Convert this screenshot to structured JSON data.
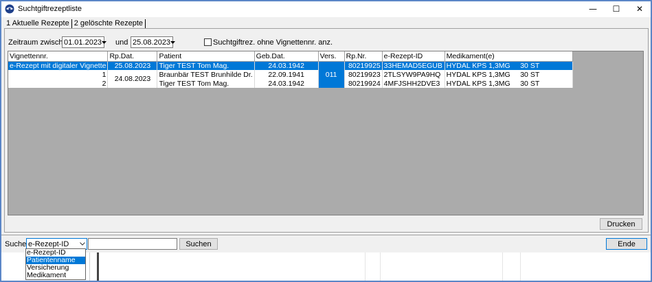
{
  "window": {
    "title": "Suchtgiftrezeptliste",
    "minimize": "—",
    "maximize": "☐",
    "close": "✕"
  },
  "tabs": [
    {
      "label": "1 Aktuelle Rezepte",
      "active": true
    },
    {
      "label": "2 gelöschte Rezepte",
      "active": false
    }
  ],
  "filter": {
    "zeitraum_label": "Zeitraum zwischen",
    "date_from": "01.01.2023",
    "und_label": "und",
    "date_to": "25.08.2023",
    "checkbox_label": "Suchtgiftrez. ohne Vignettennr. anz."
  },
  "grid": {
    "columns": [
      "Vignettennr.",
      "Rp.Dat.",
      "Patient",
      "Geb.Dat.",
      "Vers.",
      "Rp.Nr.",
      "e-Rezept-ID",
      "Medikament(e)"
    ],
    "rows": [
      {
        "vignette": "e-Rezept mit digitaler Vignette",
        "rpdat": "25.08.2023",
        "patient": "Tiger TEST Tom Mag.",
        "gebdat": "24.03.1942",
        "vers": "",
        "rpnr": "80219925",
        "erezept": "33HEMAD5EGUB",
        "med": "HYDAL KPS 1,3MG     30 ST"
      },
      {
        "vignette": "1",
        "rpdat": "",
        "patient": "Braunbär TEST Brunhilde Dr.",
        "gebdat": "22.09.1941",
        "vers": "",
        "rpnr": "80219923",
        "erezept": "2TLSYW9PA9HQ",
        "med": "HYDAL KPS 1,3MG     30 ST"
      },
      {
        "vignette": "2",
        "rpdat": "",
        "patient": "Tiger TEST Tom Mag.",
        "gebdat": "24.03.1942",
        "vers": "",
        "rpnr": "80219924",
        "erezept": "4MFJSHH2DVE3",
        "med": "HYDAL KPS 1,3MG     30 ST"
      }
    ],
    "merged_rpdat": "24.08.2023",
    "merged_vers": "011"
  },
  "buttons": {
    "drucken": "Drucken",
    "suchen": "Suchen",
    "ende": "Ende"
  },
  "search": {
    "label": "Suche",
    "selected": "e-Rezept-ID",
    "value": "",
    "options": [
      "e-Rezept-ID",
      "Patientenname",
      "Versicherung",
      "Medikament"
    ],
    "highlighted": "Patientenname"
  },
  "colors": {
    "selection": "#0078d7",
    "grid_background": "#ababab",
    "window_border": "#5b86c7"
  }
}
